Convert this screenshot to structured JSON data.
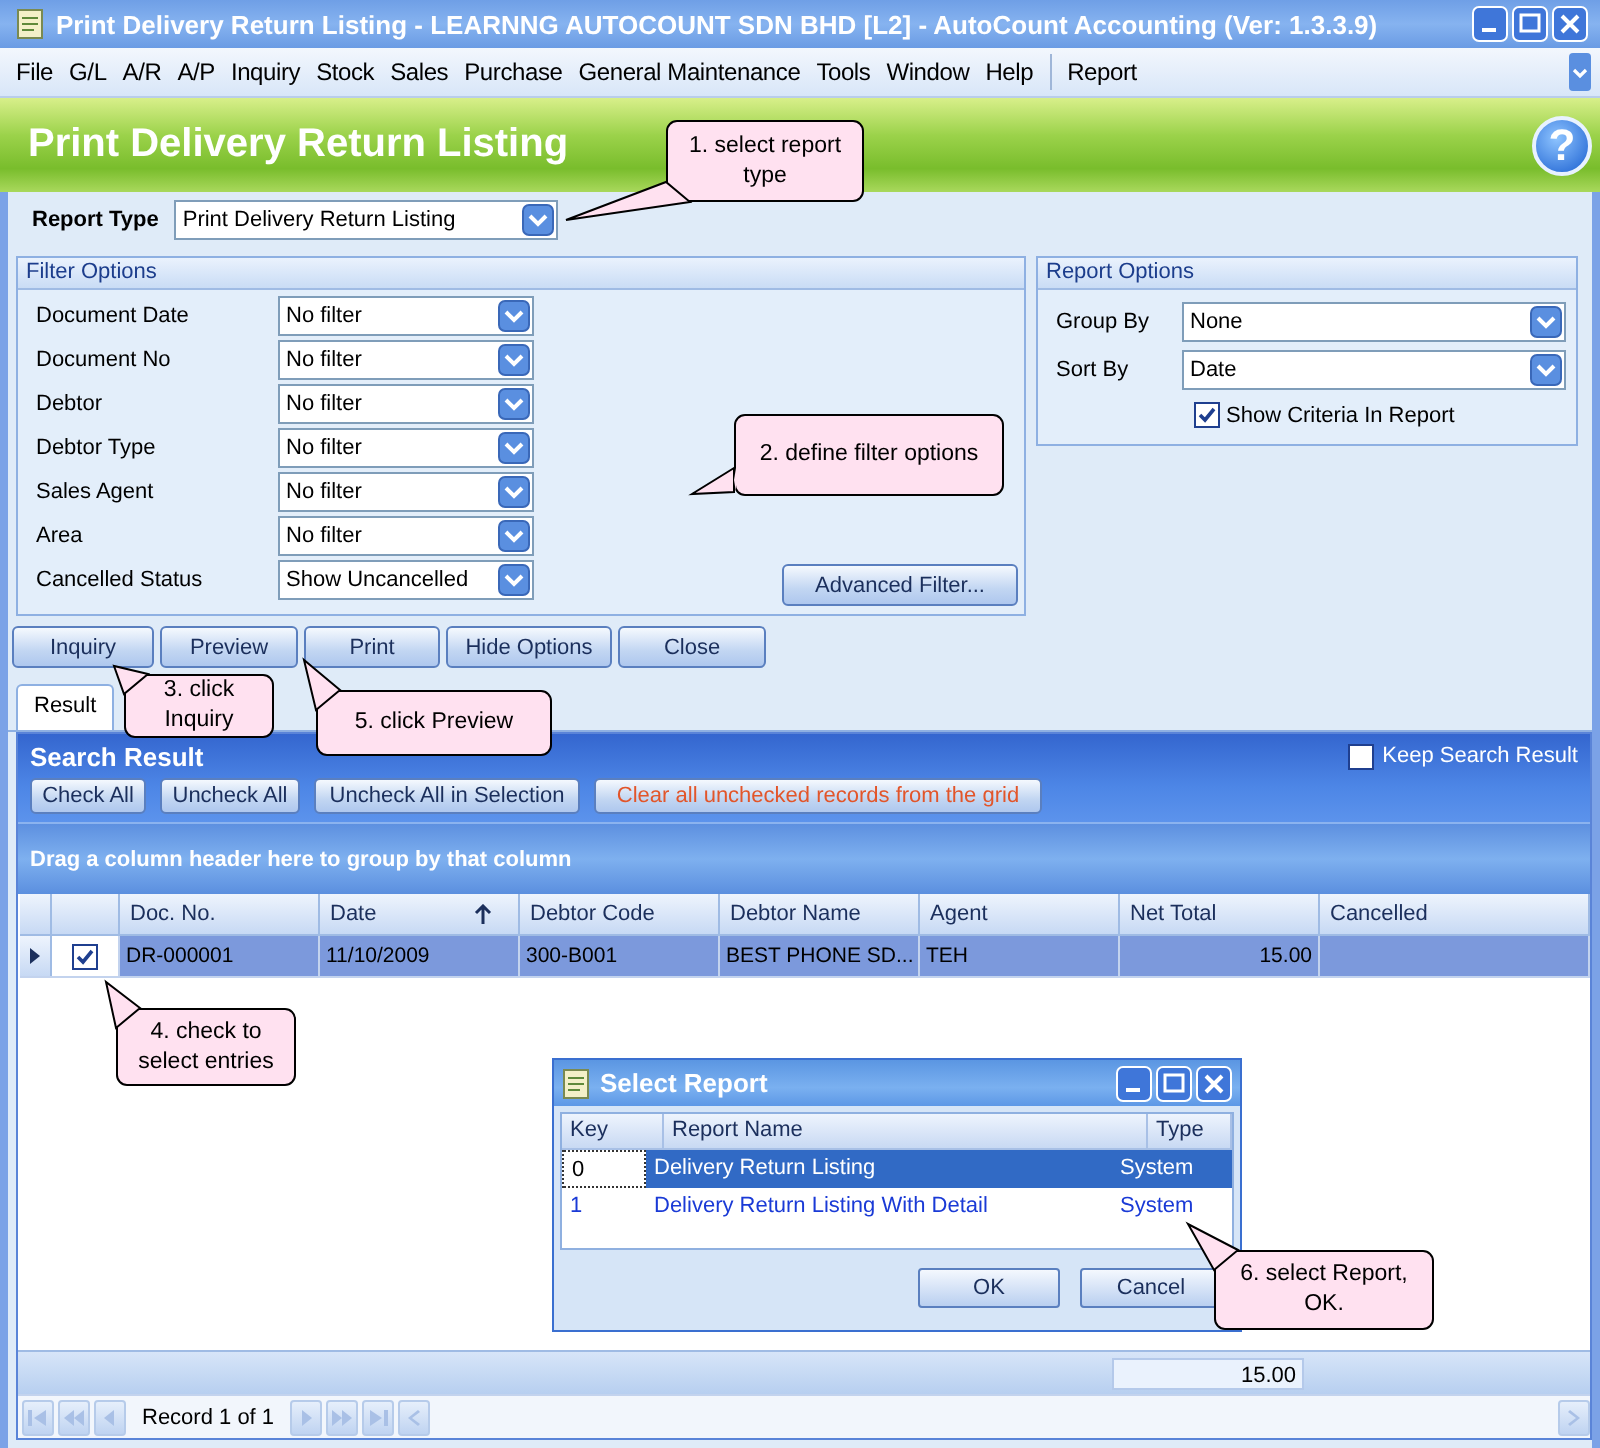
{
  "window": {
    "title": "Print Delivery Return Listing - LEARNNG AUTOCOUNT SDN BHD [L2] - AutoCount Accounting (Ver: 1.3.3.9)"
  },
  "menu": [
    {
      "label": "File"
    },
    {
      "label": "G/L"
    },
    {
      "label": "A/R"
    },
    {
      "label": "A/P"
    },
    {
      "label": "Inquiry"
    },
    {
      "label": "Stock"
    },
    {
      "label": "Sales"
    },
    {
      "label": "Purchase"
    },
    {
      "label": "General Maintenance"
    },
    {
      "label": "Tools"
    },
    {
      "label": "Window"
    },
    {
      "label": "Help"
    }
  ],
  "menu_extra": [
    {
      "label": "Report"
    }
  ],
  "header": {
    "title": "Print Delivery Return Listing",
    "help_icon": "?"
  },
  "report_type": {
    "label": "Report Type",
    "value": "Print Delivery Return Listing"
  },
  "filter_options": {
    "title": "Filter Options",
    "filters": [
      {
        "label": "Document Date",
        "value": "No filter"
      },
      {
        "label": "Document No",
        "value": "No filter"
      },
      {
        "label": "Debtor",
        "value": "No filter"
      },
      {
        "label": "Debtor Type",
        "value": "No filter"
      },
      {
        "label": "Sales Agent",
        "value": "No filter"
      },
      {
        "label": "Area",
        "value": "No filter"
      },
      {
        "label": "Cancelled Status",
        "value": "Show Uncancelled"
      }
    ],
    "advanced_button": "Advanced Filter..."
  },
  "report_options": {
    "title": "Report Options",
    "group_by": {
      "label": "Group By",
      "value": "None"
    },
    "sort_by": {
      "label": "Sort By",
      "value": "Date"
    },
    "show_criteria": {
      "label": "Show Criteria In Report",
      "checked": true
    }
  },
  "actions": [
    "Inquiry",
    "Preview",
    "Print",
    "Hide Options",
    "Close"
  ],
  "tabs": [
    {
      "label": "Result",
      "selected": true
    }
  ],
  "search_result": {
    "title": "Search Result",
    "keep_search_result": {
      "label": "Keep Search Result",
      "checked": false
    },
    "buttons": [
      {
        "label": "Check All",
        "kind": "normal"
      },
      {
        "label": "Uncheck All",
        "kind": "normal"
      },
      {
        "label": "Uncheck All in Selection",
        "kind": "normal"
      },
      {
        "label": "Clear all unchecked records from the grid",
        "kind": "warning"
      }
    ],
    "group_panel": "Drag a column header here to group by that column",
    "table": {
      "columns": [
        {
          "label": "Doc. No.",
          "sorted": false
        },
        {
          "label": "Date",
          "sorted": true
        },
        {
          "label": "Debtor Code",
          "sorted": false
        },
        {
          "label": "Debtor Name",
          "sorted": false
        },
        {
          "label": "Agent",
          "sorted": false
        },
        {
          "label": "Net Total",
          "sorted": false
        },
        {
          "label": "Cancelled",
          "sorted": false
        }
      ],
      "rows": [
        {
          "checked": true,
          "selected": true,
          "cells": [
            "DR-000001",
            "11/10/2009",
            "300-B001",
            "BEST PHONE SD...",
            "TEH",
            "15.00",
            ""
          ]
        }
      ]
    },
    "summary": {
      "net_total": "15.00"
    },
    "navigator": {
      "record": "Record 1 of 1"
    }
  },
  "dialog": {
    "title": "Select Report",
    "columns": [
      "Key",
      "Report Name",
      "Type"
    ],
    "rows": [
      {
        "key": "0",
        "name": "Delivery Return Listing",
        "type": "System",
        "selected": true
      },
      {
        "key": "1",
        "name": "Delivery Return Listing With Detail",
        "type": "System",
        "selected": false
      }
    ],
    "buttons": [
      "OK",
      "Cancel"
    ]
  },
  "callouts": [
    {
      "text": "1. select report type"
    },
    {
      "text": "2. define filter options"
    },
    {
      "text": "3. click Inquiry"
    },
    {
      "text": "5. click Preview"
    },
    {
      "text": "4. check to select entries"
    },
    {
      "text": "6. select Report, OK."
    }
  ]
}
